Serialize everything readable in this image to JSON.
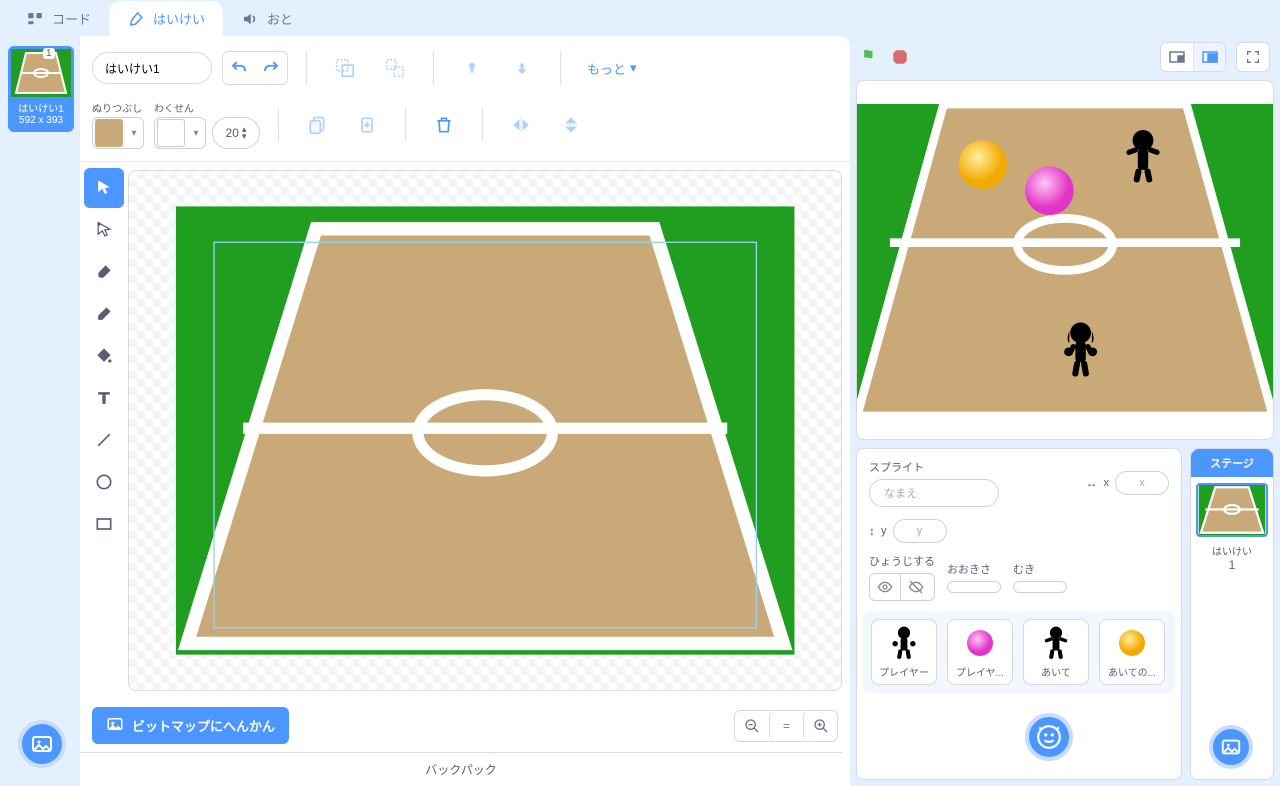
{
  "tabs": {
    "code": "コード",
    "costumes": "はいけい",
    "sounds": "おと"
  },
  "costume_rail": {
    "index": "1",
    "name": "はいけい1",
    "size": "592 x 393"
  },
  "editor": {
    "costume_name": "はいけい1",
    "fill_label": "ぬりつぶし",
    "outline_label": "わくせん",
    "outline_width": "20",
    "more_label": "もっと",
    "convert_label": "ビットマップにへんかん"
  },
  "backpack_label": "バックパック",
  "sprite_panel": {
    "title": "スプライト",
    "name_placeholder": "なまえ",
    "x_label": "x",
    "y_label": "y",
    "x_placeholder": "x",
    "y_placeholder": "y",
    "show_label": "ひょうじする",
    "size_label": "おおきさ",
    "direction_label": "むき"
  },
  "sprites": [
    {
      "name": "プレイヤー"
    },
    {
      "name": "プレイヤ..."
    },
    {
      "name": "あいて"
    },
    {
      "name": "あいての..."
    }
  ],
  "stage_panel": {
    "label": "ステージ",
    "backdrop_label": "はいけい",
    "count": "1"
  }
}
